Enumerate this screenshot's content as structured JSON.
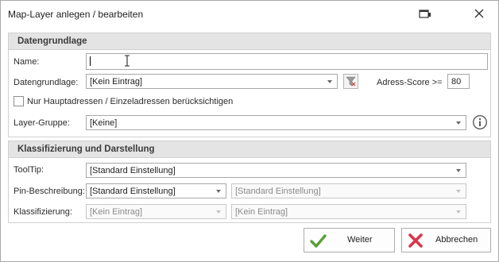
{
  "window": {
    "title": "Map-Layer anlegen / bearbeiten"
  },
  "group1": {
    "header": "Datengrundlage",
    "name_label": "Name:",
    "name_value": "",
    "datengrundlage_label": "Datengrundlage:",
    "datengrundlage_value": "[Kein Eintrag]",
    "score_label": "Adress-Score >=",
    "score_value": "80",
    "checkbox_label": "Nur Hauptadressen / Einzeladressen berücksichtigen",
    "layergruppe_label": "Layer-Gruppe:",
    "layergruppe_value": "[Keine]"
  },
  "group2": {
    "header": "Klassifizierung und Darstellung",
    "tooltip_label": "ToolTip:",
    "tooltip_value": "[Standard Einstellung]",
    "pin_label": "Pin-Beschreibung:",
    "pin_value1": "[Standard Einstellung]",
    "pin_value2": "[Standard Einstellung]",
    "klass_label": "Klassifizierung:",
    "klass_value1": "[Kein Eintrag]",
    "klass_value2": "[Kein Eintrag]"
  },
  "buttons": {
    "weiter": "Weiter",
    "abbrechen": "Abbrechen"
  },
  "colors": {
    "accept_green": "#5a9e3a",
    "cancel_red": "#d9344a",
    "header_bg": "#e4e4e4"
  },
  "icons": [
    "restore-icon",
    "close-icon",
    "filter-icon",
    "info-icon",
    "checkmark-icon",
    "cross-icon",
    "text-cursor-icon"
  ]
}
